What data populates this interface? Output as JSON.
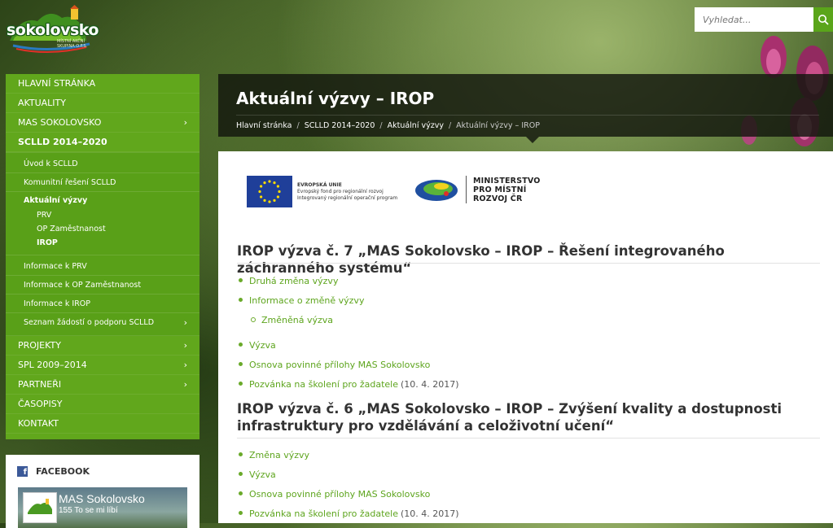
{
  "logo": {
    "name": "sokolovsko",
    "subtitle": "MÍSTNÍ AKČNÍ SKUPINA O.P.S."
  },
  "search": {
    "placeholder": "Vyhledat..."
  },
  "nav": {
    "items_top": [
      {
        "label": "HLAVNÍ STRÁNKA",
        "chevron": ""
      },
      {
        "label": "AKTUALITY",
        "chevron": ""
      },
      {
        "label": "MAS SOKOLOVSKO",
        "chevron": "›"
      },
      {
        "label": "SCLLD 2014–2020",
        "chevron": ""
      }
    ],
    "sub_items": [
      {
        "label": "Úvod k SCLLD"
      },
      {
        "label": "Komunitní řešení SCLLD"
      }
    ],
    "open_sub": {
      "label": "Aktuální výzvy"
    },
    "subsub_items": [
      {
        "label": "PRV"
      },
      {
        "label": "OP Zaměstnanost"
      },
      {
        "label": "IROP"
      }
    ],
    "sub_items_after": [
      {
        "label": "Informace k PRV",
        "chevron": ""
      },
      {
        "label": "Informace k OP Zaměstnanost",
        "chevron": ""
      },
      {
        "label": "Informace k IROP",
        "chevron": ""
      },
      {
        "label": "Seznam žádostí o podporu SCLLD",
        "chevron": "›"
      }
    ],
    "items_bottom": [
      {
        "label": "PROJEKTY",
        "chevron": "›"
      },
      {
        "label": "SPL 2009–2014",
        "chevron": "›"
      },
      {
        "label": "PARTNEŘI",
        "chevron": "›"
      },
      {
        "label": "ČASOPISY",
        "chevron": ""
      },
      {
        "label": "KONTAKT",
        "chevron": ""
      }
    ]
  },
  "facebook": {
    "heading": "FACEBOOK",
    "page_name": "MAS Sokolovsko",
    "likes": "155 To se mi líbí"
  },
  "page": {
    "title": "Aktuální výzvy – IROP",
    "breadcrumb": [
      "Hlavní stránka",
      "SCLLD 2014–2020",
      "Aktuální výzvy",
      "Aktuální výzvy – IROP"
    ],
    "sep": "/"
  },
  "logos": {
    "eu_line1": "EVROPSKÁ UNIE",
    "eu_line2": "Evropský fond pro regionální rozvoj",
    "eu_line3": "Integrovaný regionální operační program",
    "mmr_line1": "MINISTERSTVO",
    "mmr_line2": "PRO MÍSTNÍ",
    "mmr_line3": "ROZVOJ ČR"
  },
  "sections": [
    {
      "title": "IROP výzva č. 7 „MAS Sokolovsko – IROP – Řešení integrovaného záchranného systému“",
      "links": [
        {
          "text": "Druhá změna výzvy",
          "note": ""
        },
        {
          "text": "Informace o změně výzvy",
          "note": ""
        },
        {
          "text": "Změněná výzva",
          "note": ""
        },
        {
          "text": "Výzva",
          "note": ""
        },
        {
          "text": "Osnova povinné přílohy MAS Sokolovsko",
          "note": ""
        },
        {
          "text": "Pozvánka na školení pro žadatele",
          "note": "(10. 4. 2017)"
        }
      ]
    },
    {
      "title": "IROP výzva č. 6 „MAS Sokolovsko – IROP – Zvýšení kvality a dostupnosti infrastruktury pro vzdělávání a celoživotní učení“",
      "links": [
        {
          "text": "Změna výzvy",
          "note": ""
        },
        {
          "text": "Výzva",
          "note": ""
        },
        {
          "text": "Osnova povinné přílohy MAS Sokolovsko",
          "note": ""
        },
        {
          "text": "Pozvánka na školení pro žadatele",
          "note": "(10. 4. 2017)"
        }
      ]
    }
  ]
}
